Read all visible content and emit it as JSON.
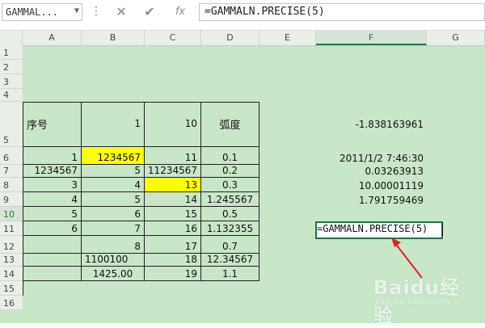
{
  "formula_bar": {
    "name_box": "GAMMAL...",
    "cancel_icon": "✕",
    "enter_icon": "✔",
    "fx_label": "fx",
    "formula": "=GAMMALN.PRECISE(5)"
  },
  "columns": [
    "A",
    "B",
    "C",
    "D",
    "E",
    "F",
    "G"
  ],
  "active_column": "F",
  "rows": [
    "1",
    "2",
    "3",
    "4",
    "5",
    "6",
    "7",
    "8",
    "9",
    "10",
    "11",
    "12",
    "13",
    "14",
    "15",
    "16"
  ],
  "active_row": "10",
  "table": {
    "header": {
      "A": "序号",
      "B": "1",
      "C": "10",
      "D": "弧度"
    },
    "rows": [
      {
        "A": "1",
        "B": "1234567",
        "C": "11",
        "D": "0.1",
        "F": "2011/1/2 7:46:30"
      },
      {
        "A": "1234567",
        "B": "5",
        "C": "11234567",
        "D": "0.2",
        "F": "0.03263913"
      },
      {
        "A": "3",
        "B": "4",
        "C": "13",
        "D": "0.3",
        "F": "10.00001119"
      },
      {
        "A": "4",
        "B": "5",
        "C": "14",
        "D": "1.245567",
        "F": "1.791759469"
      },
      {
        "A": "5",
        "B": "6",
        "C": "15",
        "D": "0.5",
        "F": "=GAMMALN.PRECISE(5)"
      },
      {
        "A": "6",
        "B": "7",
        "C": "16",
        "D": "1.132355",
        "F": ""
      },
      {
        "A": "",
        "B": "8",
        "C": "17",
        "D": "0.7",
        "F": ""
      },
      {
        "A": "",
        "B": "1100100",
        "C": "18",
        "D": "12.34567",
        "F": ""
      },
      {
        "A": "",
        "B": "1425.00",
        "C": "19",
        "D": "1.1",
        "F": ""
      }
    ],
    "f5": "-1.838163961"
  },
  "highlight_color": "#ffff00",
  "sheet_bg": "#c8e6c8",
  "accent": "#217346",
  "arrow_color": "#e02020",
  "watermark": {
    "logo": "Baidu经验",
    "url": "jingyan.baidu.com"
  }
}
